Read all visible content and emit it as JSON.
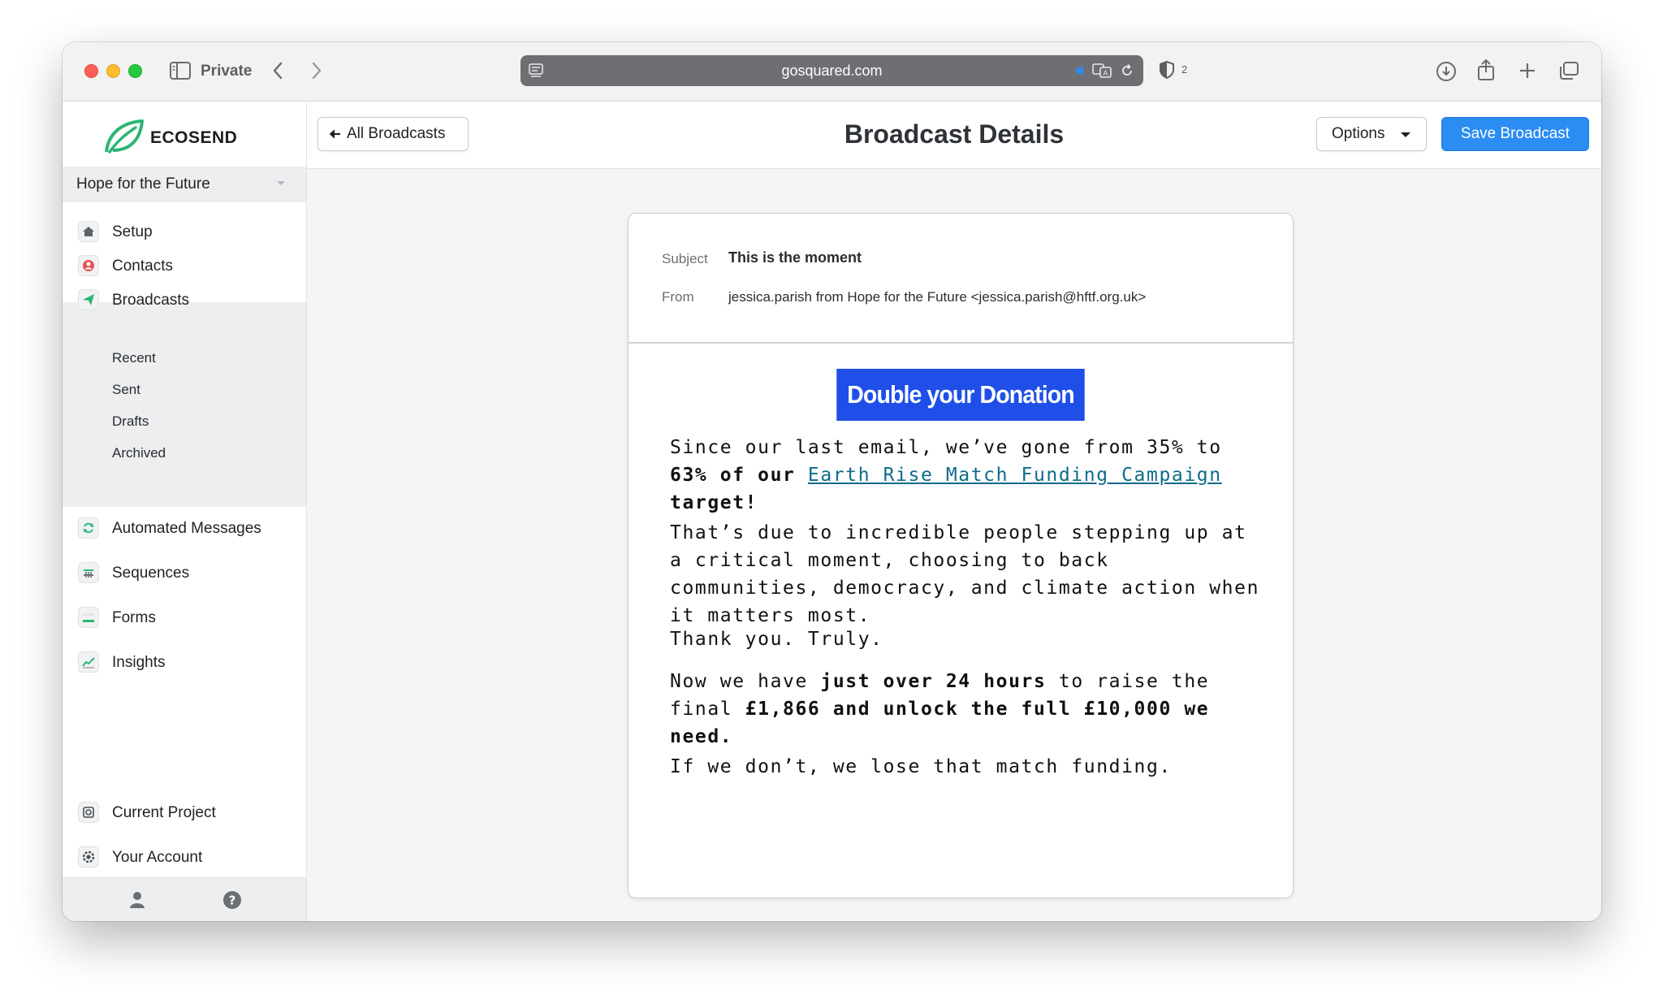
{
  "browser": {
    "private_label": "Private",
    "url": "gosquared.com",
    "shield_count": "2"
  },
  "sidebar": {
    "logo_text": "ECOSEND",
    "project": "Hope for the Future",
    "items": [
      {
        "label": "Setup",
        "icon": "home-icon"
      },
      {
        "label": "Contacts",
        "icon": "contacts-icon"
      },
      {
        "label": "Broadcasts",
        "icon": "paper-plane-icon"
      },
      {
        "label": "Automated Messages",
        "icon": "refresh-icon"
      },
      {
        "label": "Sequences",
        "icon": "sequences-icon"
      },
      {
        "label": "Forms",
        "icon": "forms-icon"
      },
      {
        "label": "Insights",
        "icon": "chart-icon"
      }
    ],
    "broadcast_subitems": [
      "Recent",
      "Sent",
      "Drafts",
      "Archived"
    ],
    "bottom_items": [
      {
        "label": "Current Project",
        "icon": "project-icon"
      },
      {
        "label": "Your Account",
        "icon": "account-gear-icon"
      }
    ]
  },
  "topbar": {
    "back_label": "All Broadcasts",
    "title": "Broadcast Details",
    "options_label": "Options",
    "save_label": "Save Broadcast"
  },
  "email": {
    "subject_label": "Subject",
    "subject": "This is the moment",
    "from_label": "From",
    "from": "jessica.parish from Hope for the Future <jessica.parish@hftf.org.uk>",
    "cta": "Double your Donation",
    "p1_a": "Since our last email, we’ve gone from 35% to ",
    "p1_b": "63% of our ",
    "p1_link": "Earth Rise Match Funding Campaign",
    "p1_c": "target!",
    "p2": "That’s due to incredible people stepping up at a critical moment, choosing to back communities, democracy, and climate action when it matters most.",
    "p3": "Thank you. Truly.",
    "p4_a": "Now we have ",
    "p4_b": "just over 24 hours",
    "p4_c": " to raise the final ",
    "p4_d": "£1,866 and unlock the full £10,000 we need.",
    "p5": "If we don’t, we lose that match funding."
  },
  "colors": {
    "primary": "#2b8cf2",
    "cta": "#1f4fe8",
    "link": "#0e6b8c",
    "logo_green": "#2bb673"
  }
}
